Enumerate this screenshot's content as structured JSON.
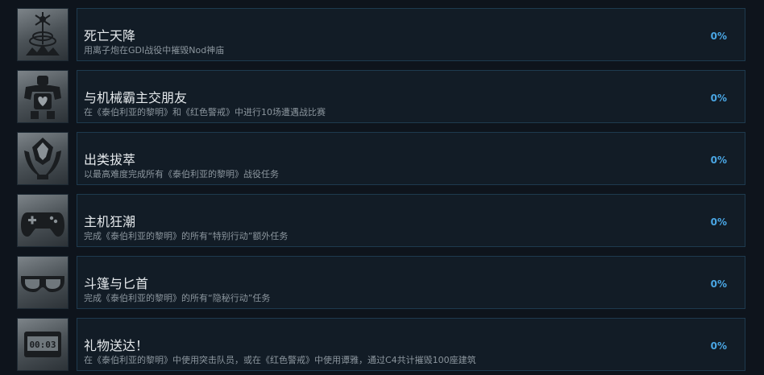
{
  "achievements": [
    {
      "title": "死亡天降",
      "description": "用离子炮在GDI战役中摧毁Nod神庙",
      "percent": "0%",
      "icon": "ion-cannon-icon"
    },
    {
      "title": "与机械霸主交朋友",
      "description": "在《泰伯利亚的黎明》和《红色警戒》中进行10场遭遇战比赛",
      "percent": "0%",
      "icon": "mech-overlord-icon"
    },
    {
      "title": "出类拔萃",
      "description": "以最高难度完成所有《泰伯利亚的黎明》战役任务",
      "percent": "0%",
      "icon": "emblem-icon"
    },
    {
      "title": "主机狂潮",
      "description": "完成《泰伯利亚的黎明》的所有“特别行动”额外任务",
      "percent": "0%",
      "icon": "gamepad-icon"
    },
    {
      "title": "斗篷与匕首",
      "description": "完成《泰伯利亚的黎明》的所有“隐秘行动”任务",
      "percent": "0%",
      "icon": "goggles-icon"
    },
    {
      "title": "礼物送达！",
      "description": "在《泰伯利亚的黎明》中使用突击队员，或在《红色警戒》中使用谭雅，通过C4共计摧毁100座建筑",
      "percent": "0%",
      "icon": "timer-icon",
      "icon_text": "00:03"
    }
  ]
}
